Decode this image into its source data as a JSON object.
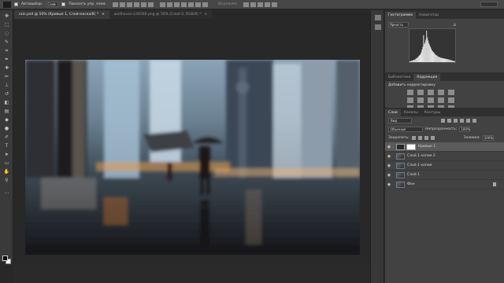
{
  "options_bar": {
    "auto_select_label": "Автовыбор:",
    "auto_select_value": "Слой",
    "show_transform_label": "Показать упр. элем.",
    "mode_3d_label": "3D-режим:"
  },
  "tabs": [
    {
      "label": "rain.psd @ 50% (Кривые 1, Слой-маска/8) *",
      "close": "×",
      "active": true
    },
    {
      "label": "wallhaven-144566.png @ 50% (Слой 0, RGB/8) *",
      "close": "×",
      "active": false
    }
  ],
  "histogram_panel": {
    "tabs": [
      "Гистограмма",
      "Навигатор"
    ],
    "channel": "Яркость",
    "histogram_levels": [
      2,
      2,
      3,
      3,
      4,
      5,
      5,
      6,
      8,
      9,
      10,
      12,
      14,
      16,
      18,
      22,
      28,
      34,
      60,
      40,
      44,
      50,
      70,
      55,
      48,
      42,
      38,
      34,
      30,
      26,
      24,
      22,
      20,
      18,
      16,
      15,
      14,
      12,
      12,
      11,
      10,
      10,
      9,
      9,
      8,
      8,
      8,
      7,
      7,
      7,
      6,
      6,
      5,
      5,
      4,
      4,
      3,
      3,
      2,
      2
    ]
  },
  "adjustments_panel": {
    "tabs": [
      "Библиотеки",
      "Коррекция"
    ],
    "title": "Добавить корректировку"
  },
  "layers_panel": {
    "tabs": [
      "Слои",
      "Каналы",
      "Контуры"
    ],
    "filter_kind": "Вид",
    "blend_mode": "Обычные",
    "opacity_label": "Непрозрачность:",
    "opacity_value": "100%",
    "lock_label": "Закрепить:",
    "fill_label": "Заливка:",
    "fill_value": "100%",
    "layers": [
      {
        "name": "Кривые 1",
        "type": "adjustment",
        "selected": true
      },
      {
        "name": "Слой 1 копия 2",
        "type": "pixel",
        "selected": false
      },
      {
        "name": "Слой 1 копия",
        "type": "pixel",
        "selected": false
      },
      {
        "name": "Слой 1",
        "type": "pixel",
        "selected": false
      },
      {
        "name": "Фон",
        "type": "pixel",
        "selected": false,
        "locked": true
      }
    ]
  }
}
